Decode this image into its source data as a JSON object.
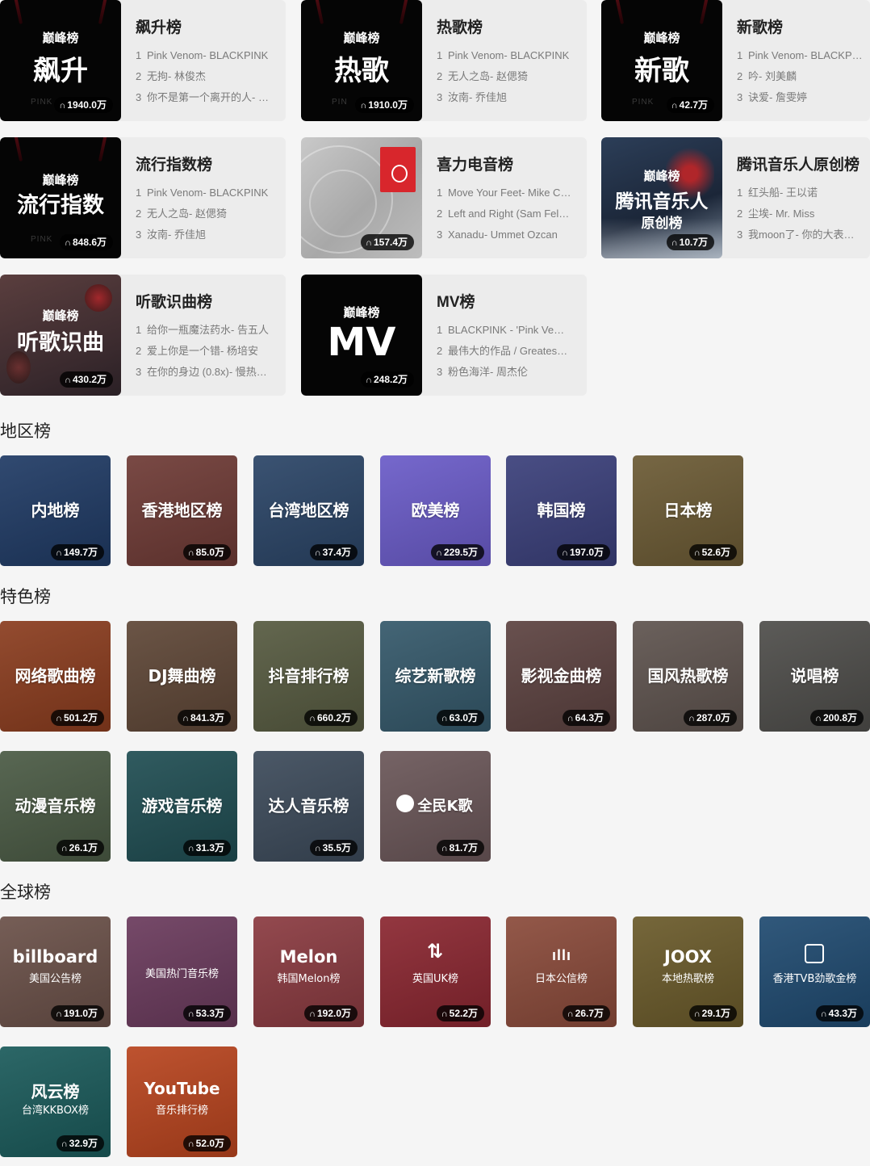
{
  "top_charts": [
    {
      "cover_logo": "巅峰榜",
      "cover_text": "飙升",
      "plays": "1940.0万",
      "title": "飙升榜",
      "bp_mark": "PINK",
      "songs": [
        {
          "rank": "1",
          "name": "Pink Venom- BLACKPINK"
        },
        {
          "rank": "2",
          "name": "无拘- 林俊杰"
        },
        {
          "rank": "3",
          "name": "你不是第一个离开的人- …"
        }
      ]
    },
    {
      "cover_logo": "巅峰榜",
      "cover_text": "热歌",
      "plays": "1910.0万",
      "title": "热歌榜",
      "bp_mark": "PIN",
      "songs": [
        {
          "rank": "1",
          "name": "Pink Venom- BLACKPINK"
        },
        {
          "rank": "2",
          "name": "无人之岛- 赵偲猗"
        },
        {
          "rank": "3",
          "name": "汝南- 乔佳旭"
        }
      ]
    },
    {
      "cover_logo": "巅峰榜",
      "cover_text": "新歌",
      "plays": "42.7万",
      "title": "新歌榜",
      "bp_mark": "PINK",
      "songs": [
        {
          "rank": "1",
          "name": "Pink Venom- BLACKPINK"
        },
        {
          "rank": "2",
          "name": "吟- 刘美麟"
        },
        {
          "rank": "3",
          "name": "诀爱- 詹雯婷"
        }
      ]
    },
    {
      "cover_logo": "巅峰榜",
      "cover_text": "流行指数",
      "plays": "848.6万",
      "title": "流行指数榜",
      "bp_mark": "PINK",
      "songs": [
        {
          "rank": "1",
          "name": "Pink Venom- BLACKPINK"
        },
        {
          "rank": "2",
          "name": "无人之岛- 赵偲猗"
        },
        {
          "rank": "3",
          "name": "汝南- 乔佳旭"
        }
      ]
    },
    {
      "cover_logo": "",
      "cover_text": "",
      "plays": "157.4万",
      "title": "喜力电音榜",
      "bp_mark": "",
      "songs": [
        {
          "rank": "1",
          "name": "Move Your Feet- Mike C…"
        },
        {
          "rank": "2",
          "name": "Left and Right (Sam Fel…"
        },
        {
          "rank": "3",
          "name": "Xanadu- Ummet Ozcan"
        }
      ]
    },
    {
      "cover_logo": "巅峰榜",
      "cover_text": "腾讯音乐人",
      "cover_text2": "原创榜",
      "plays": "10.7万",
      "title": "腾讯音乐人原创榜",
      "bp_mark": "",
      "songs": [
        {
          "rank": "1",
          "name": "红头船- 王以诺"
        },
        {
          "rank": "2",
          "name": "尘埃- Mr. Miss"
        },
        {
          "rank": "3",
          "name": "我moon了- 你的大表哥…"
        }
      ]
    },
    {
      "cover_logo": "巅峰榜",
      "cover_text": "听歌识曲",
      "plays": "430.2万",
      "title": "听歌识曲榜",
      "bp_mark": "",
      "songs": [
        {
          "rank": "1",
          "name": "给你一瓶魔法药水- 告五人"
        },
        {
          "rank": "2",
          "name": "爱上你是一个错- 杨培安"
        },
        {
          "rank": "3",
          "name": "在你的身边 (0.8x)- 慢热…"
        }
      ]
    },
    {
      "cover_logo": "巅峰榜",
      "cover_text": "MV",
      "plays": "248.2万",
      "title": "MV榜",
      "bp_mark": "",
      "songs": [
        {
          "rank": "1",
          "name": "BLACKPINK - 'Pink Ve…"
        },
        {
          "rank": "2",
          "name": "最伟大的作品 / Greates…"
        },
        {
          "rank": "3",
          "name": "粉色海洋- 周杰伦"
        }
      ]
    }
  ],
  "region_section": {
    "title": "地区榜",
    "items": [
      {
        "label": "内地榜",
        "plays": "149.7万",
        "bg": "#1f3a64"
      },
      {
        "label": "香港地区榜",
        "plays": "85.0万",
        "bg": "#6e3a35"
      },
      {
        "label": "台湾地区榜",
        "plays": "37.4万",
        "bg": "#2a4466"
      },
      {
        "label": "欧美榜",
        "plays": "229.5万",
        "bg": "#6a5bc8"
      },
      {
        "label": "韩国榜",
        "plays": "197.0万",
        "bg": "#3a3f7a"
      },
      {
        "label": "日本榜",
        "plays": "52.6万",
        "bg": "#6b5a34"
      }
    ]
  },
  "feature_section": {
    "title": "特色榜",
    "items": [
      {
        "label": "网络歌曲榜",
        "plays": "501.2万",
        "bg": "#8a3c1e"
      },
      {
        "label": "DJ舞曲榜",
        "plays": "841.3万",
        "bg": "#5e4636"
      },
      {
        "label": "抖音排行榜",
        "plays": "660.2万",
        "bg": "#565a40"
      },
      {
        "label": "综艺新歌榜",
        "plays": "63.0万",
        "bg": "#34586a"
      },
      {
        "label": "影视金曲榜",
        "plays": "64.3万",
        "bg": "#5c4240"
      },
      {
        "label": "国风热歌榜",
        "plays": "287.0万",
        "bg": "#5e534e"
      },
      {
        "label": "说唱榜",
        "plays": "200.8万",
        "bg": "#4e4d4a"
      },
      {
        "label": "动漫音乐榜",
        "plays": "26.1万",
        "bg": "#4a5a44"
      },
      {
        "label": "游戏音乐榜",
        "plays": "31.3万",
        "bg": "#1f4d52"
      },
      {
        "label": "达人音乐榜",
        "plays": "35.5万",
        "bg": "#3c4a5a"
      },
      {
        "label": "全民K歌",
        "plays": "81.7万",
        "bg": "#6a5658",
        "icon": "k-song-icon"
      }
    ]
  },
  "global_section": {
    "title": "全球榜",
    "items": [
      {
        "brand": "billboard",
        "sub": "美国公告榜",
        "plays": "191.0万",
        "bg": "#6a5048"
      },
      {
        "brand": "",
        "sub": "美国热门音乐榜",
        "plays": "53.3万",
        "bg": "#6a3a5c"
      },
      {
        "brand": "Melon",
        "sub": "韩国Melon榜",
        "plays": "192.0万",
        "bg": "#8a3a40"
      },
      {
        "brand": "",
        "sub": "英国UK榜",
        "plays": "52.2万",
        "bg": "#8a2630",
        "icon": "uk-arrows-icon"
      },
      {
        "brand": "",
        "sub": "日本公信榜",
        "plays": "26.7万",
        "bg": "#8a4a3a",
        "icon": "oricon-bars-icon"
      },
      {
        "brand": "JOOX",
        "sub": "本地热歌榜",
        "plays": "29.1万",
        "bg": "#6a5a2a"
      },
      {
        "brand": "",
        "sub": "香港TVB劲歌金榜",
        "plays": "43.3万",
        "bg": "#1f4a70",
        "icon": "tvb-icon"
      },
      {
        "brand": "风云榜",
        "sub": "台湾KKBOX榜",
        "plays": "32.9万",
        "bg": "#1a5a5a"
      },
      {
        "brand": "YouTube",
        "sub": "音乐排行榜",
        "plays": "52.0万",
        "bg": "#b8441e"
      }
    ]
  }
}
